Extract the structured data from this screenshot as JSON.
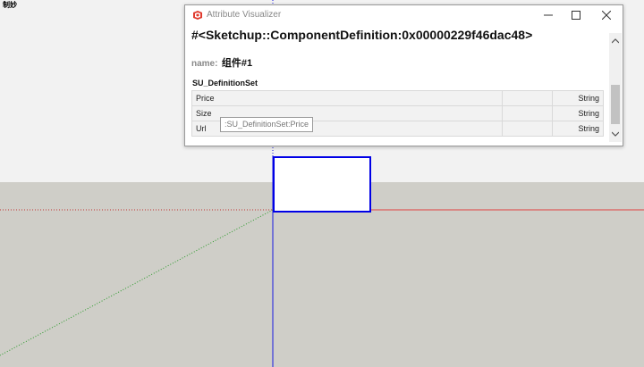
{
  "scene": {
    "label": "制妙"
  },
  "window": {
    "title": "Attribute Visualizer",
    "icons": {
      "app": "sketchup-logo-icon",
      "minimize": "minimize-icon",
      "maximize": "maximize-icon",
      "close": "close-icon"
    },
    "heading": "#<Sketchup::ComponentDefinition:0x00000229f46dac48>",
    "name_label": "name:",
    "name_value": "组件#1",
    "dictionary": {
      "title": "SU_DefinitionSet",
      "columns_visible": [
        "",
        "",
        ""
      ],
      "rows": [
        {
          "key": "Price",
          "value": "",
          "type": "String"
        },
        {
          "key": "Size",
          "value": "",
          "type": "String"
        },
        {
          "key": "Url",
          "value": "",
          "type": "String"
        }
      ]
    },
    "tooltip": ":SU_DefinitionSet:Price"
  },
  "colors": {
    "selection": "#0000e6",
    "red_axis": "#e04040",
    "green_axis": "#2a9a2a",
    "blue_axis": "#1a1ae0",
    "sky": "#f2f2f2",
    "ground": "#cfcec8",
    "sketchup_red": "#e03a2e"
  }
}
